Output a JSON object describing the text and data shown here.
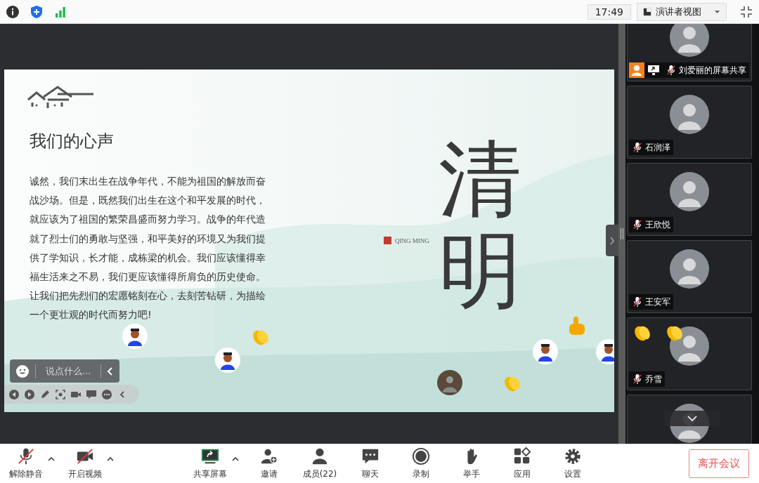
{
  "top_bar": {
    "time": "17:49",
    "view_mode": "演讲者视图"
  },
  "slide": {
    "title": "我们的心声",
    "body": "诚然，我们末出生在战争年代，不能为祖国的解放而奋战沙场。但是，既然我们出生在这个和平发展的时代，就应该为了祖国的繁荣昌盛而努力学习。战争的年代造就了烈士们的勇敢与坚强，和平美好的环境又为我们提供了学知识，长才能，成栋梁的机会。我们应该懂得幸福生活来之不易，我们更应该懂得所肩负的历史使命。让我们把先烈们的宏愿铭刻在心，去刻苦钻研，为描绘一个更壮观的时代而努力吧!",
    "art_title": "清明",
    "art_subtitle": "QING MING"
  },
  "chat": {
    "placeholder": "说点什么..."
  },
  "participants": [
    {
      "name": "刘爱丽的屏幕共享",
      "muted": true,
      "sharing": true
    },
    {
      "name": "石润泽",
      "muted": true
    },
    {
      "name": "王欣悦",
      "muted": true
    },
    {
      "name": "王安军",
      "muted": true
    },
    {
      "name": "乔雪",
      "muted": true,
      "clapping": true
    }
  ],
  "toolbar": [
    {
      "kind": "mic",
      "label": "解除静音",
      "off": true,
      "menu": true
    },
    {
      "kind": "video",
      "label": "开启视频",
      "off": true,
      "menu": true
    },
    {
      "kind": "share",
      "label": "共享屏幕",
      "menu": true
    },
    {
      "kind": "invite",
      "label": "邀请"
    },
    {
      "kind": "members",
      "label": "成员(22)"
    },
    {
      "kind": "chat",
      "label": "聊天"
    },
    {
      "kind": "record",
      "label": "录制"
    },
    {
      "kind": "hand",
      "label": "举手"
    },
    {
      "kind": "apps",
      "label": "应用"
    },
    {
      "kind": "settings",
      "label": "设置"
    }
  ],
  "leave_button": "离开会议"
}
